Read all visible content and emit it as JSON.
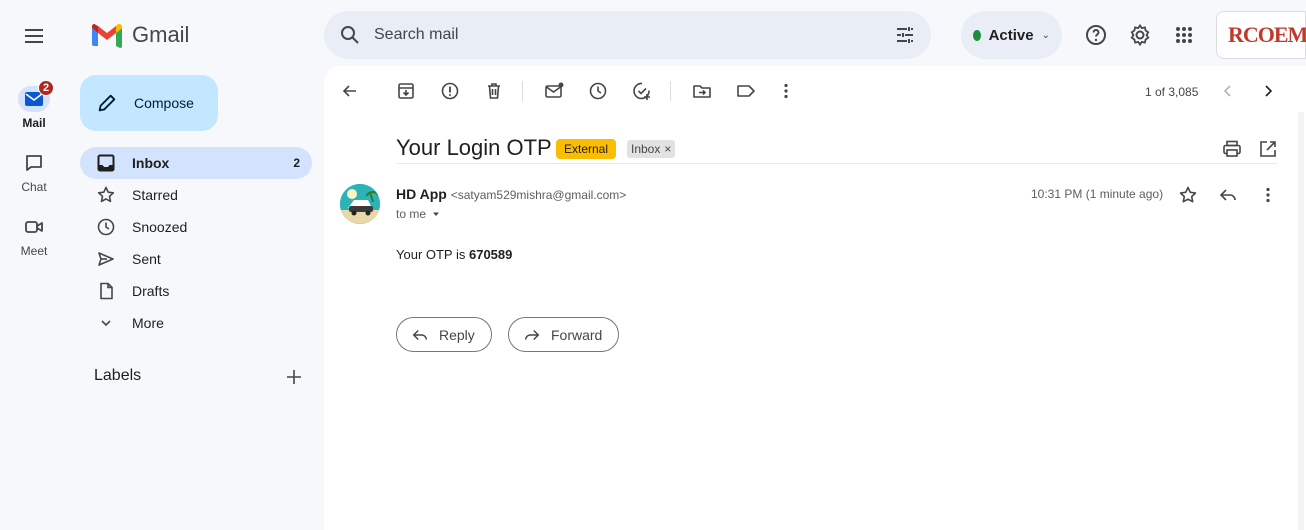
{
  "app": {
    "name": "Gmail"
  },
  "search": {
    "placeholder": "Search mail"
  },
  "status": {
    "label": "Active",
    "color": "#1e8e3e"
  },
  "account": {
    "text": "RCOEM"
  },
  "rail": [
    {
      "label": "Mail",
      "badge": "2",
      "icon": "mail-icon"
    },
    {
      "label": "Chat",
      "icon": "chat-icon"
    },
    {
      "label": "Meet",
      "icon": "video-icon"
    }
  ],
  "compose": {
    "label": "Compose"
  },
  "nav": [
    {
      "label": "Inbox",
      "count": "2",
      "icon": "inbox-icon"
    },
    {
      "label": "Starred",
      "icon": "star-icon"
    },
    {
      "label": "Snoozed",
      "icon": "clock-icon"
    },
    {
      "label": "Sent",
      "icon": "send-icon"
    },
    {
      "label": "Drafts",
      "icon": "draft-icon"
    },
    {
      "label": "More",
      "icon": "chevron-down-icon"
    }
  ],
  "labels": {
    "heading": "Labels"
  },
  "toolbar": {
    "pager": "1 of 3,085"
  },
  "email": {
    "subject": "Your Login OTP",
    "tags": {
      "external": "External",
      "inbox": "Inbox"
    },
    "sender_name": "HD App",
    "sender_email": "<satyam529mishra@gmail.com>",
    "recipient": "to me",
    "time": "10:31 PM (1 minute ago)",
    "body_prefix": "Your OTP is ",
    "otp": "670589"
  },
  "actions": {
    "reply": "Reply",
    "forward": "Forward"
  },
  "colors": {
    "accent": "#d3e3fd",
    "compose": "#c2e7ff",
    "external_tag": "#fbbc04",
    "badge": "#b3261e"
  }
}
